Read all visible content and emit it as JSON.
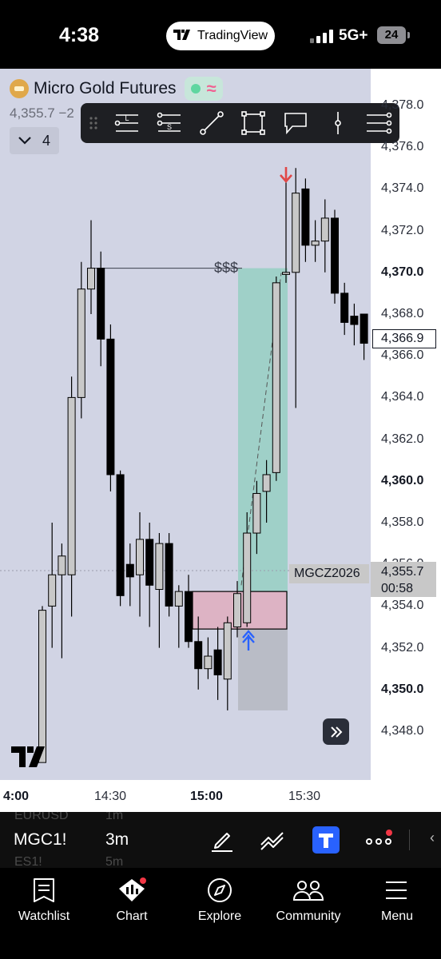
{
  "status_bar": {
    "time": "4:38",
    "app_pill": "TradingView",
    "network": "5G+",
    "battery": "24"
  },
  "legend": {
    "symbol_name": "Micro Gold Futures",
    "price": "4,355.7  −2",
    "indicator_count": "4"
  },
  "drawing_toolbar": {
    "tools": [
      "long-position-icon",
      "short-position-icon",
      "trend-line-icon",
      "rectangle-icon",
      "callout-icon",
      "vertical-line-icon",
      "more-menu-icon"
    ],
    "long_letter": "L",
    "short_letter": "S"
  },
  "chart": {
    "annotation_label": "$$$",
    "symbol_tag": "MGCZ2026",
    "current_price": "4,355.7",
    "countdown": "00:58",
    "crosshair_price": "4,366.9",
    "x_ticks": [
      {
        "label": "4:00",
        "bold": true
      },
      {
        "label": "14:30",
        "bold": false
      },
      {
        "label": "15:00",
        "bold": true
      },
      {
        "label": "15:30",
        "bold": false
      }
    ],
    "y_ticks": [
      {
        "label": "4,378.0",
        "bold": false
      },
      {
        "label": "4,376.0",
        "bold": false
      },
      {
        "label": "4,374.0",
        "bold": false
      },
      {
        "label": "4,372.0",
        "bold": false
      },
      {
        "label": "4,370.0",
        "bold": true
      },
      {
        "label": "4,368.0",
        "bold": false
      },
      {
        "label": "4,366.0",
        "bold": false
      },
      {
        "label": "4,364.0",
        "bold": false
      },
      {
        "label": "4,362.0",
        "bold": false
      },
      {
        "label": "4,360.0",
        "bold": true
      },
      {
        "label": "4,358.0",
        "bold": false
      },
      {
        "label": "4,356.0",
        "bold": false
      },
      {
        "label": "4,354.0",
        "bold": false
      },
      {
        "label": "4,352.0",
        "bold": false
      },
      {
        "label": "4,350.0",
        "bold": true
      },
      {
        "label": "4,348.0",
        "bold": false
      }
    ],
    "colors": {
      "background": "#d1d4e4",
      "up_candle": "#c8c8c8",
      "down_candle": "#000000",
      "profit_zone": "#9fd0c8",
      "loss_zone": "#b9bcc6",
      "entry_box": "#ddb3c4",
      "sell_arrow": "#e04848",
      "buy_arrow": "#2962ff"
    }
  },
  "chart_data": {
    "type": "candlestick",
    "ylim": [
      4346.5,
      4379.2
    ],
    "candles": [
      {
        "o": 4346.5,
        "h": 4354.0,
        "l": 4346.5,
        "c": 4353.8
      },
      {
        "o": 4354.0,
        "h": 4358.0,
        "l": 4352.0,
        "c": 4355.5
      },
      {
        "o": 4355.5,
        "h": 4357.0,
        "l": 4351.5,
        "c": 4356.4
      },
      {
        "o": 4355.5,
        "h": 4365.0,
        "l": 4353.5,
        "c": 4364.0
      },
      {
        "o": 4364.0,
        "h": 4370.5,
        "l": 4363.0,
        "c": 4369.2
      },
      {
        "o": 4369.2,
        "h": 4372.5,
        "l": 4368.0,
        "c": 4370.2
      },
      {
        "o": 4370.2,
        "h": 4371.0,
        "l": 4365.5,
        "c": 4366.8
      },
      {
        "o": 4366.8,
        "h": 4367.5,
        "l": 4359.5,
        "c": 4360.3
      },
      {
        "o": 4360.3,
        "h": 4360.5,
        "l": 4354.0,
        "c": 4354.5
      },
      {
        "o": 4356.0,
        "h": 4357.0,
        "l": 4354.0,
        "c": 4355.4
      },
      {
        "o": 4355.5,
        "h": 4358.5,
        "l": 4353.5,
        "c": 4357.2
      },
      {
        "o": 4357.2,
        "h": 4358.0,
        "l": 4353.0,
        "c": 4355.0
      },
      {
        "o": 4354.8,
        "h": 4357.5,
        "l": 4352.0,
        "c": 4357.0
      },
      {
        "o": 4357.0,
        "h": 4357.5,
        "l": 4353.5,
        "c": 4354.0
      },
      {
        "o": 4354.0,
        "h": 4355.0,
        "l": 4352.0,
        "c": 4354.7
      },
      {
        "o": 4354.7,
        "h": 4355.5,
        "l": 4352.0,
        "c": 4352.3
      },
      {
        "o": 4352.3,
        "h": 4353.5,
        "l": 4350.0,
        "c": 4351.0
      },
      {
        "o": 4351.0,
        "h": 4352.5,
        "l": 4350.5,
        "c": 4351.6
      },
      {
        "o": 4351.9,
        "h": 4353.0,
        "l": 4349.5,
        "c": 4350.7
      },
      {
        "o": 4350.5,
        "h": 4353.5,
        "l": 4349.0,
        "c": 4353.2
      },
      {
        "o": 4353.0,
        "h": 4355.2,
        "l": 4352.5,
        "c": 4354.6
      },
      {
        "o": 4353.2,
        "h": 4358.5,
        "l": 4353.0,
        "c": 4357.5
      },
      {
        "o": 4357.5,
        "h": 4360.0,
        "l": 4356.5,
        "c": 4359.4
      },
      {
        "o": 4359.5,
        "h": 4361.0,
        "l": 4358.0,
        "c": 4360.3
      },
      {
        "o": 4360.4,
        "h": 4369.8,
        "l": 4360.0,
        "c": 4369.5
      },
      {
        "o": 4369.9,
        "h": 4374.5,
        "l": 4369.5,
        "c": 4370.0
      },
      {
        "o": 4370.0,
        "h": 4375.0,
        "l": 4363.5,
        "c": 4373.8
      },
      {
        "o": 4374.0,
        "h": 4374.5,
        "l": 4370.5,
        "c": 4371.3
      },
      {
        "o": 4371.3,
        "h": 4372.5,
        "l": 4370.5,
        "c": 4371.5
      },
      {
        "o": 4371.5,
        "h": 4373.5,
        "l": 4370.0,
        "c": 4372.6
      },
      {
        "o": 4372.6,
        "h": 4373.0,
        "l": 4368.5,
        "c": 4369.0
      },
      {
        "o": 4369.0,
        "h": 4369.5,
        "l": 4367.0,
        "c": 4367.6
      },
      {
        "o": 4367.9,
        "h": 4368.5,
        "l": 4366.5,
        "c": 4367.5
      },
      {
        "o": 4368.0,
        "h": 4368.0,
        "l": 4365.8,
        "c": 4366.6
      }
    ],
    "annotation_level": 4370.2,
    "position": {
      "entry": 4353.8,
      "target": 4370.2,
      "stop": 4349.0,
      "box_top": 4354.7,
      "box_bottom": 4352.9
    },
    "current_price": 4355.7
  },
  "bottom_toolbar": {
    "symbol": "MGC1!",
    "interval": "3m",
    "ghost_rows": [
      {
        "sym": "EURUSD",
        "int": "1m"
      },
      {
        "sym": "ES1!",
        "int": "5m"
      }
    ]
  },
  "bottom_nav": {
    "items": [
      {
        "label": "Watchlist",
        "icon": "watchlist-icon"
      },
      {
        "label": "Chart",
        "icon": "chart-icon"
      },
      {
        "label": "Explore",
        "icon": "compass-icon"
      },
      {
        "label": "Community",
        "icon": "community-icon"
      },
      {
        "label": "Menu",
        "icon": "menu-icon"
      }
    ]
  }
}
